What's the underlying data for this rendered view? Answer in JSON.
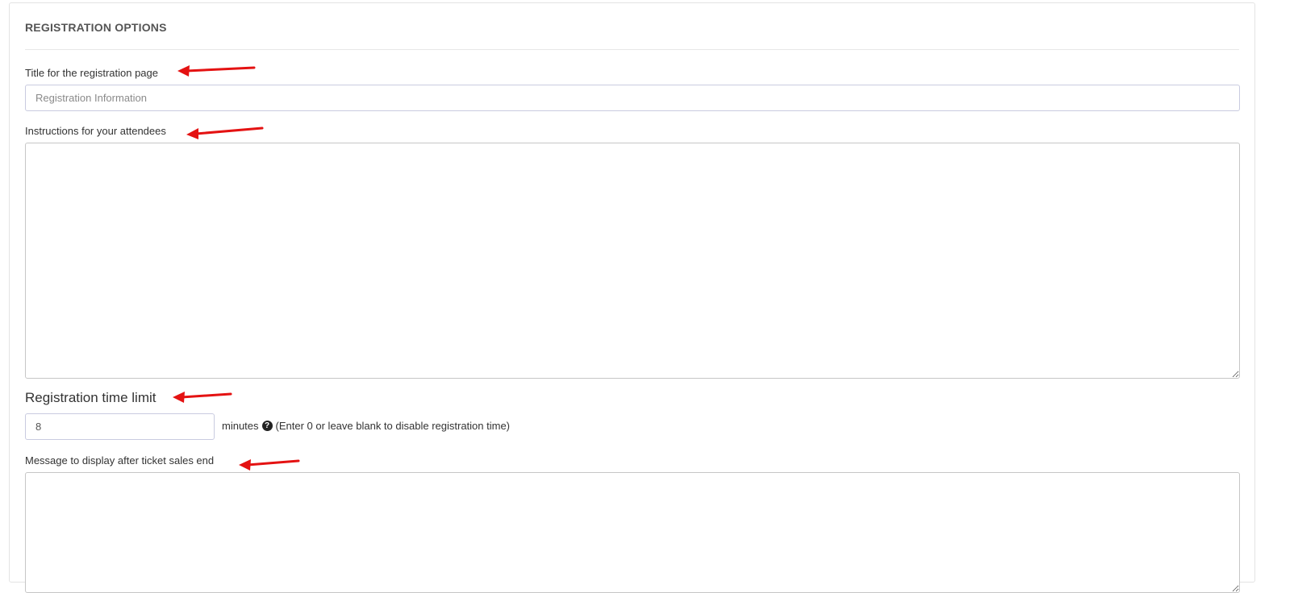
{
  "section": {
    "title": "REGISTRATION OPTIONS"
  },
  "fields": {
    "page_title": {
      "label": "Title for the registration page",
      "placeholder": "Registration Information",
      "value": ""
    },
    "instructions": {
      "label": "Instructions for your attendees",
      "value": ""
    },
    "time_limit": {
      "label": "Registration time limit",
      "value": "8",
      "unit": "minutes",
      "help": "(Enter 0 or leave blank to disable registration time)"
    },
    "after_sales_message": {
      "label": "Message to display after ticket sales end",
      "value": ""
    }
  },
  "annotations": {
    "arrow_color": "#e41212"
  },
  "icons": {
    "help": "question-circle-icon"
  }
}
